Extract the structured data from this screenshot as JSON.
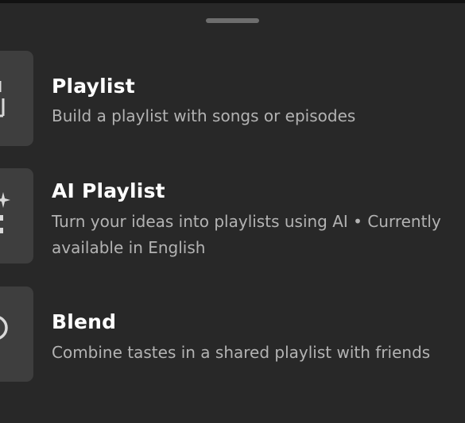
{
  "sheet": {
    "options": [
      {
        "id": "playlist",
        "icon": "playlist-icon",
        "title": "Playlist",
        "description": "Build a playlist with songs or episodes"
      },
      {
        "id": "ai-playlist",
        "icon": "sparkle-icon",
        "title": "AI Playlist",
        "description_line1": "Turn your ideas into playlists using AI • Currently",
        "description_line2": "available in English"
      },
      {
        "id": "blend",
        "icon": "blend-icon",
        "title": "Blend",
        "description": "Combine tastes in a shared playlist with friends"
      }
    ]
  },
  "colors": {
    "background": "#282828",
    "tile": "#3e3e3e",
    "title": "#ffffff",
    "description": "#b3b3b3",
    "handle": "#6e6e6e"
  }
}
